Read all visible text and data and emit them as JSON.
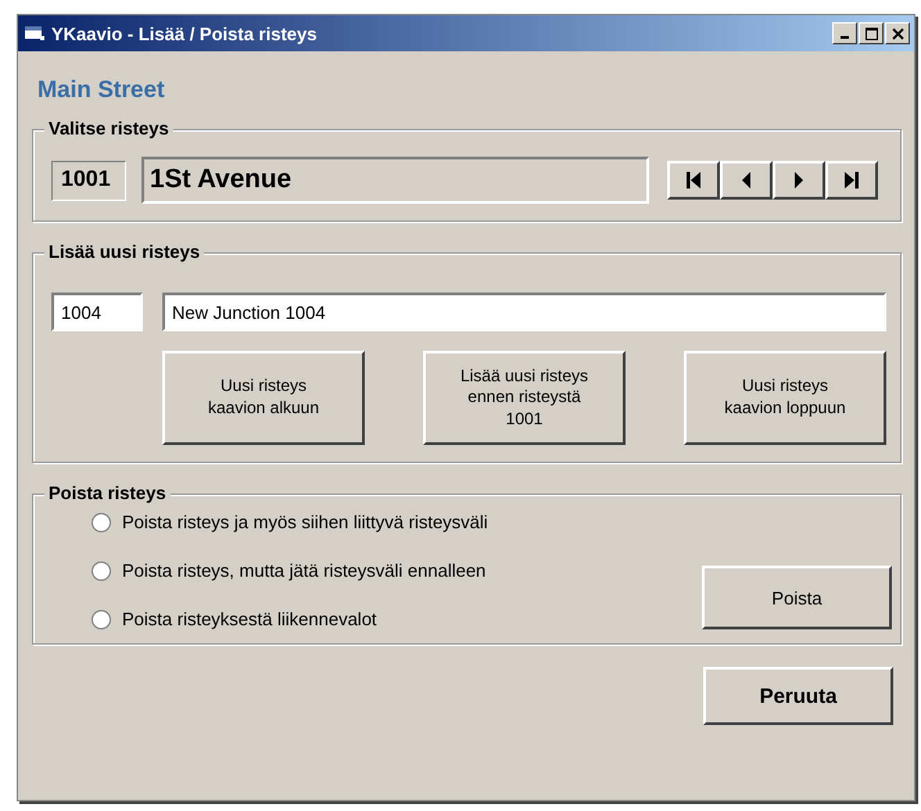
{
  "window": {
    "title": "YKaavio - Lisää / Poista risteys"
  },
  "heading": "Main Street",
  "select_group": {
    "legend": "Valitse risteys",
    "id": "1001",
    "name": "1St Avenue"
  },
  "add_group": {
    "legend": "Lisää uusi risteys",
    "id_value": "1004",
    "name_value": "New Junction 1004",
    "buttons": [
      "Uusi risteys kaavion alkuun",
      "Lisää uusi risteys ennen risteystä 1001",
      "Uusi risteys kaavion loppuun"
    ]
  },
  "delete_group": {
    "legend": "Poista risteys",
    "options": [
      {
        "label": "Poista risteys ja myös siihen liittyvä risteysväli",
        "selected": false
      },
      {
        "label": "Poista risteys, mutta jätä risteysväli ennalleen",
        "selected": false
      },
      {
        "label": "Poista risteyksestä liikennevalot",
        "selected": false
      }
    ],
    "button": "Poista"
  },
  "cancel_button": "Peruuta"
}
